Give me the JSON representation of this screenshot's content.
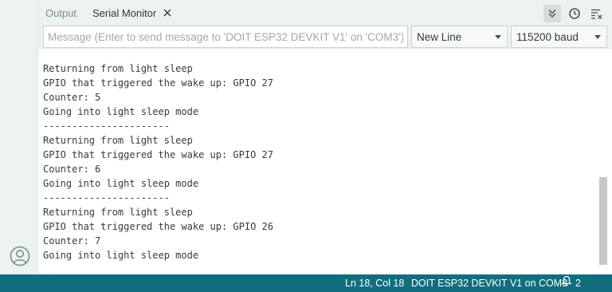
{
  "tabs": [
    {
      "label": "Output",
      "active": false
    },
    {
      "label": "Serial Monitor",
      "active": true
    }
  ],
  "header_tools": [
    "toggle-autoscroll-icon",
    "toggle-timestamp-icon",
    "clear-output-icon"
  ],
  "toolbar": {
    "message_placeholder": "Message (Enter to send message to 'DOIT ESP32 DEVKIT V1' on 'COM3')",
    "message_value": "",
    "line_ending": "New Line",
    "baud_rate": "115200 baud"
  },
  "output_lines": [
    "Returning from light sleep",
    "GPIO that triggered the wake up: GPIO 27",
    "Counter: 5",
    "Going into light sleep mode",
    "----------------------",
    "Returning from light sleep",
    "GPIO that triggered the wake up: GPIO 27",
    "Counter: 6",
    "Going into light sleep mode",
    "----------------------",
    "Returning from light sleep",
    "GPIO that triggered the wake up: GPIO 26",
    "Counter: 7",
    "Going into light sleep mode"
  ],
  "status": {
    "cursor_position": "Ln 18, Col 18",
    "board_port": "DOIT ESP32 DEVKIT V1 on COM3",
    "notification_count": "2"
  },
  "colors": {
    "status_bar": "#126e7e",
    "panel_bg": "#ecf1f1",
    "output_text": "#333b3f"
  }
}
